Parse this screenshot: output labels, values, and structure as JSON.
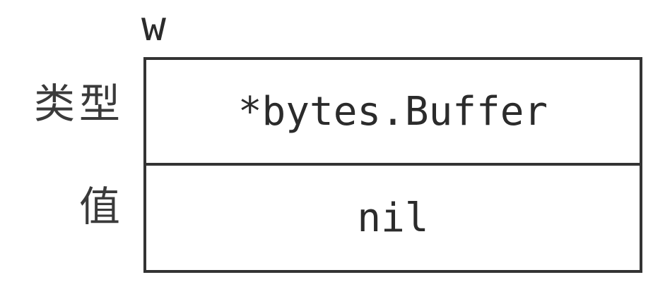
{
  "diagram": {
    "variable_name": "w",
    "labels": {
      "type": "类型",
      "value": "值"
    },
    "cells": {
      "type": "*bytes.Buffer",
      "value": "nil"
    }
  }
}
